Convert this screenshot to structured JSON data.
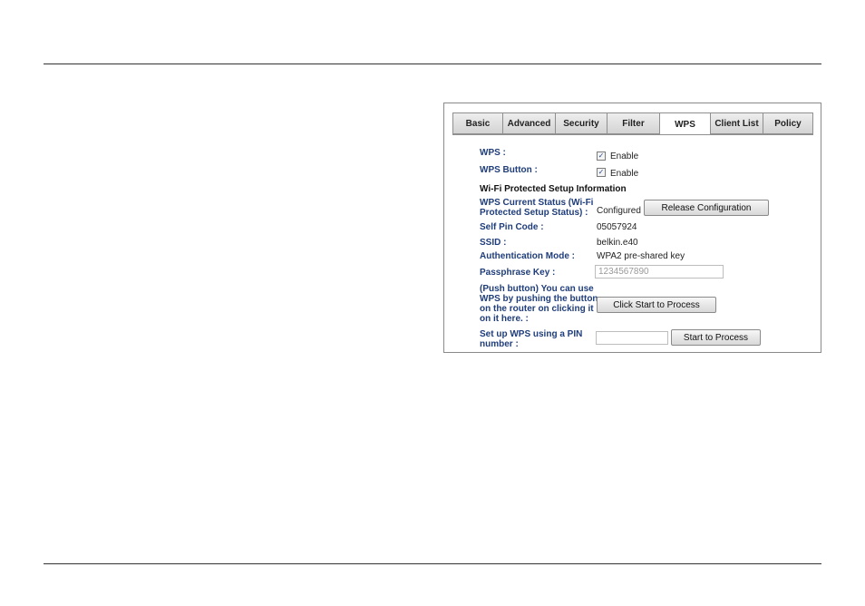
{
  "tabs": [
    {
      "label": "Basic"
    },
    {
      "label": "Advanced"
    },
    {
      "label": "Security"
    },
    {
      "label": "Filter"
    },
    {
      "label": "WPS"
    },
    {
      "label": "Client List"
    },
    {
      "label": "Policy"
    }
  ],
  "active_tab": "WPS",
  "wps": {
    "label": "WPS :",
    "enable_text": "Enable",
    "checked": true
  },
  "wps_button": {
    "label": "WPS Button :",
    "enable_text": "Enable",
    "checked": true
  },
  "section_heading": "Wi-Fi Protected Setup Information",
  "current_status": {
    "label_line1": "WPS Current Status (Wi-Fi",
    "label_line2": "Protected Setup Status) :",
    "value": "Configured",
    "button_label": "Release Configuration"
  },
  "self_pin": {
    "label": "Self Pin Code :",
    "value": "05057924"
  },
  "ssid": {
    "label": "SSID :",
    "value": "belkin.e40"
  },
  "auth_mode": {
    "label": "Authentication Mode :",
    "value": "WPA2 pre-shared key"
  },
  "passphrase": {
    "label": "Passphrase Key :",
    "value": "1234567890"
  },
  "push_button": {
    "label_line1": "(Push button) You can use",
    "label_line2": "WPS by pushing the button",
    "label_line3": "on the router on clicking it",
    "label_line4": "on it here. :",
    "button_label": "Click Start to Process"
  },
  "pin_setup": {
    "label_line1": "Set up WPS using a PIN",
    "label_line2": "number :",
    "input_value": "",
    "button_label": "Start to Process"
  },
  "icons": {
    "checkbox_mark": "checkmark-icon"
  },
  "colors": {
    "label_blue": "#1f3d7a"
  }
}
